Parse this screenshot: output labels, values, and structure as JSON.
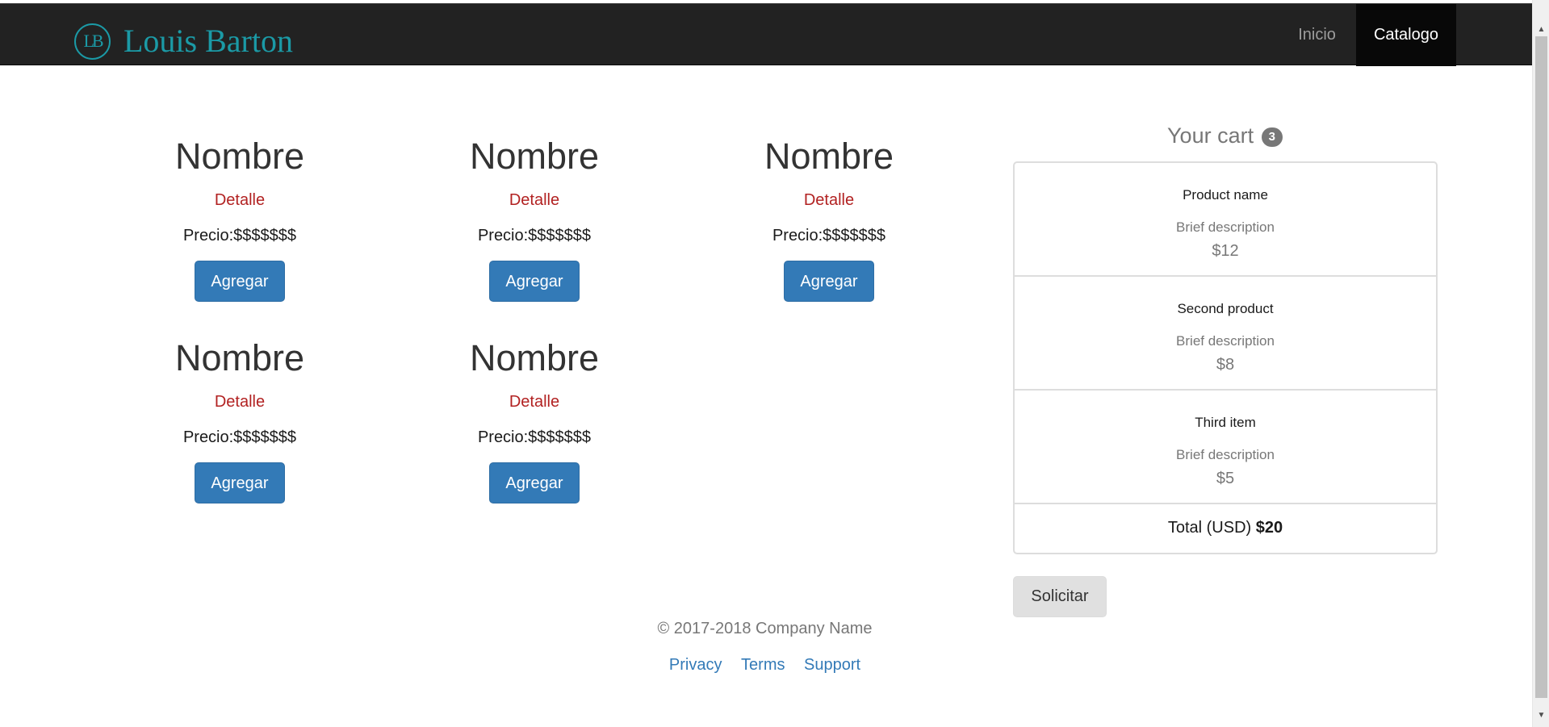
{
  "navbar": {
    "brand_monogram": "LB",
    "brand_name": "Louis Barton",
    "links": [
      {
        "label": "Inicio"
      },
      {
        "label": "Catalogo"
      }
    ]
  },
  "products": [
    {
      "name": "Nombre",
      "detail": "Detalle",
      "price": "Precio:$$$$$$$",
      "button": "Agregar"
    },
    {
      "name": "Nombre",
      "detail": "Detalle",
      "price": "Precio:$$$$$$$",
      "button": "Agregar"
    },
    {
      "name": "Nombre",
      "detail": "Detalle",
      "price": "Precio:$$$$$$$",
      "button": "Agregar"
    },
    {
      "name": "Nombre",
      "detail": "Detalle",
      "price": "Precio:$$$$$$$",
      "button": "Agregar"
    },
    {
      "name": "Nombre",
      "detail": "Detalle",
      "price": "Precio:$$$$$$$",
      "button": "Agregar"
    }
  ],
  "cart": {
    "title": "Your cart",
    "count": "3",
    "items": [
      {
        "name": "Product name",
        "description": "Brief description",
        "price": "$12"
      },
      {
        "name": "Second product",
        "description": "Brief description",
        "price": "$8"
      },
      {
        "name": "Third item",
        "description": "Brief description",
        "price": "$5"
      }
    ],
    "total_label": "Total (USD)",
    "total_value": "$20",
    "submit_label": "Solicitar"
  },
  "footer": {
    "copyright": "© 2017-2018 Company Name",
    "links": [
      "Privacy",
      "Terms",
      "Support"
    ]
  },
  "colors": {
    "navbar_bg": "#222222",
    "brand": "#1b9aa6",
    "primary": "#337ab7",
    "detail": "#b22222",
    "muted": "#777777"
  }
}
